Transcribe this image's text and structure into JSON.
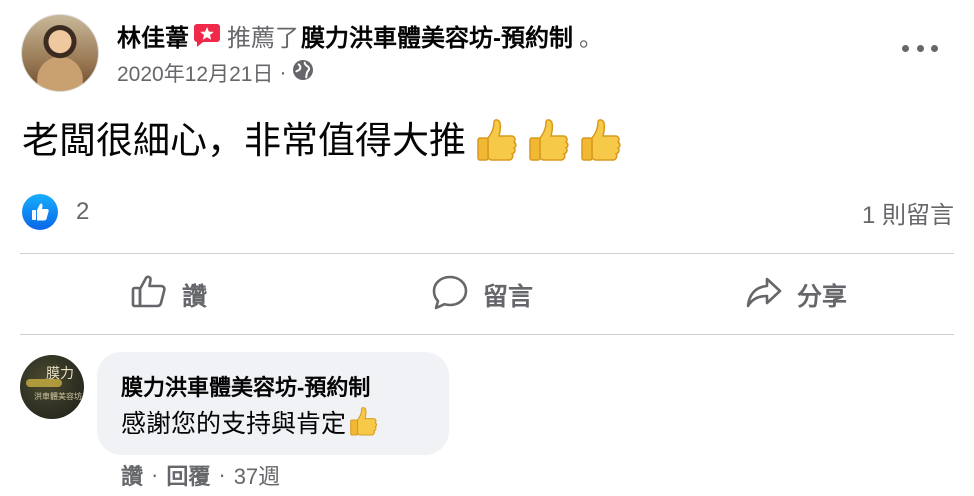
{
  "post": {
    "author": "林佳葦",
    "verb": "推薦了",
    "page_name": "膜力洪車體美容坊-預約制",
    "period": "。",
    "date": "2020年12月21日",
    "dot": "·",
    "privacy_icon": "globe-icon",
    "text": "老闆很細心，非常值得大推"
  },
  "reactions": {
    "count": "2",
    "comments_label": "1 則留言"
  },
  "actions": {
    "like": "讚",
    "comment": "留言",
    "share": "分享"
  },
  "comment": {
    "avatar_text": "膜力",
    "avatar_subtext": "洪車體美容坊",
    "author": "膜力洪車體美容坊-預約制",
    "text": "感謝您的支持與肯定",
    "like": "讚",
    "reply": "回覆",
    "sep": "·",
    "time": "37週"
  },
  "colors": {
    "accent": "#1877f2",
    "secondary_text": "#65676b",
    "bubble": "#f0f2f5",
    "divider": "#ced0d4"
  }
}
